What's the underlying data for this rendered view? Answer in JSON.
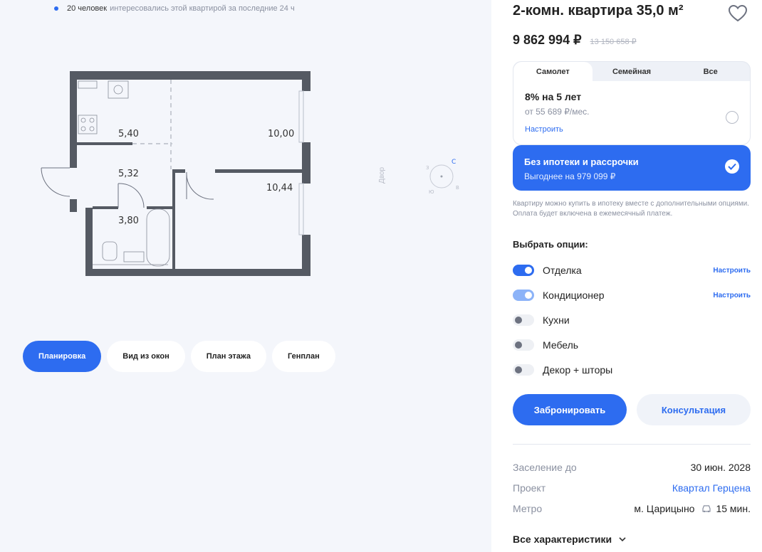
{
  "viewers": {
    "count": "20 человек",
    "text": "интересовались этой квартирой за последние 24 ч"
  },
  "plan": {
    "rooms": [
      {
        "area": "5,40"
      },
      {
        "area": "10,00"
      },
      {
        "area": "5,32"
      },
      {
        "area": "10,44"
      },
      {
        "area": "3,80"
      }
    ],
    "yard_label": "Двор",
    "compass": {
      "n": "С",
      "s": "Ю",
      "e": "В",
      "w": "З"
    }
  },
  "view_tabs": [
    {
      "label": "Планировка",
      "active": true
    },
    {
      "label": "Вид из окон",
      "active": false
    },
    {
      "label": "План этажа",
      "active": false
    },
    {
      "label": "Генплан",
      "active": false
    }
  ],
  "apartment": {
    "title": "2-комн. квартира 35,0 м²",
    "price": "9 862 994 ₽",
    "old_price": "13 150 658 ₽"
  },
  "mortgage": {
    "tabs": [
      {
        "label": "Самолет",
        "active": true
      },
      {
        "label": "Семейная",
        "active": false
      },
      {
        "label": "Все",
        "active": false
      }
    ],
    "offer": {
      "rate": "8% на 5 лет",
      "monthly": "от 55 689 ₽/мес.",
      "setup": "Настроить"
    },
    "no_mortgage": {
      "title": "Без ипотеки и рассрочки",
      "benefit": "Выгоднее на 979 099 ₽"
    },
    "note": "Квартиру можно купить в ипотеку вместе с дополнительными опциями. Оплата будет включена в ежемесячный платеж."
  },
  "options": {
    "title": "Выбрать опции:",
    "items": [
      {
        "label": "Отделка",
        "state": "on",
        "setup": "Настроить"
      },
      {
        "label": "Кондиционер",
        "state": "on-light",
        "setup": "Настроить"
      },
      {
        "label": "Кухни",
        "state": "off",
        "setup": ""
      },
      {
        "label": "Мебель",
        "state": "off",
        "setup": ""
      },
      {
        "label": "Декор + шторы",
        "state": "off",
        "setup": ""
      }
    ]
  },
  "actions": {
    "book": "Забронировать",
    "consult": "Консультация"
  },
  "specs": [
    {
      "key": "Заселение до",
      "value": "30 июн. 2028"
    },
    {
      "key": "Проект",
      "value": "Квартал Герцена"
    },
    {
      "key": "Метро",
      "value": "м. Царицыно",
      "extra": "15 мин."
    }
  ],
  "all_specs": "Все характеристики",
  "colors": {
    "accent": "#2d6cf0",
    "wall": "#555a63",
    "bg": "#f4f6fb"
  }
}
